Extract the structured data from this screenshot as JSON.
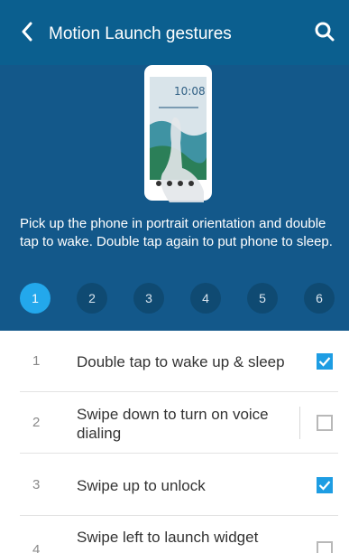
{
  "appbar": {
    "title": "Motion Launch gestures",
    "back_icon": "chevron-left-icon",
    "search_icon": "search-icon",
    "color": "#0b5f8f"
  },
  "hero": {
    "phone_clock": "10:08",
    "description": "Pick up the phone in portrait orientation and double tap to wake. Double tap again to put phone to sleep.",
    "steps": [
      "1",
      "2",
      "3",
      "4",
      "5",
      "6"
    ],
    "active_step": "1",
    "accent": "#23a8ec"
  },
  "gestures": [
    {
      "number": "1",
      "label": "Double tap to wake up & sleep",
      "checked": true
    },
    {
      "number": "2",
      "label": "Swipe down to turn on voice dialing",
      "checked": false
    },
    {
      "number": "3",
      "label": "Swipe up to unlock",
      "checked": true
    },
    {
      "number": "4",
      "label": "Swipe left to launch widget",
      "checked": false
    }
  ]
}
